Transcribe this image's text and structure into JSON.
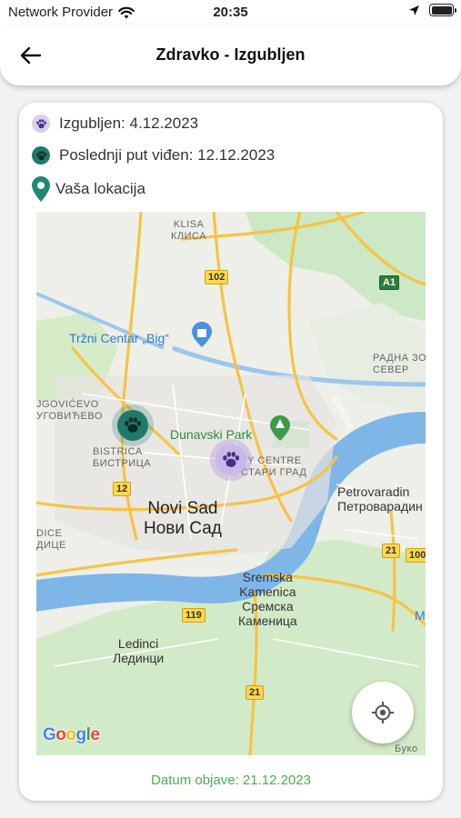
{
  "status_bar": {
    "carrier": "Network Provider",
    "time": "20:35"
  },
  "header": {
    "title": "Zdravko - Izgubljen"
  },
  "legend": {
    "lost": "Izgubljen: 4.12.2023",
    "last_seen": "Poslednji put viđen: 12.12.2023",
    "your_location": "Vaša lokacija"
  },
  "colors": {
    "lost_marker": "#a78bd6",
    "seen_marker": "#1f7a6b",
    "location_pin": "#1e8a73",
    "date_text": "#4caf50"
  },
  "map": {
    "labels": {
      "klisa": "KLISA\nКЛИСА",
      "trzni": "Tržni Centar „Big“",
      "radna": "РАДНА ЗО\nСЕВЕР",
      "jugovicevo": "JGOVIĆEVO\nУГОВИЋЕВО",
      "bistrica": "BISTRICA\nБИСТРИЦА",
      "dunavski": "Dunavski Park",
      "citycentre": "TY CENTRE\nСТАРИ ГРАД",
      "danube": "Danube",
      "novisad": "Novi Sad\nНови Сад",
      "petrovaradin": "Petrovaradin\nПетроварадин",
      "dice": "DICE\nДИЦЕ",
      "sremska": "Sremska\nKamenica\nСремска\nКаменица",
      "ledinci": "Ledinci\nЛединци",
      "buko": "Буко",
      "m_letter": "M"
    },
    "shields": {
      "s102": "102",
      "a1": "A1",
      "s12": "12",
      "s21a": "21",
      "s100": "100",
      "s119": "119",
      "s21b": "21"
    },
    "attribution": "Google"
  },
  "footer": {
    "date": "Datum objave: 21.12.2023"
  }
}
